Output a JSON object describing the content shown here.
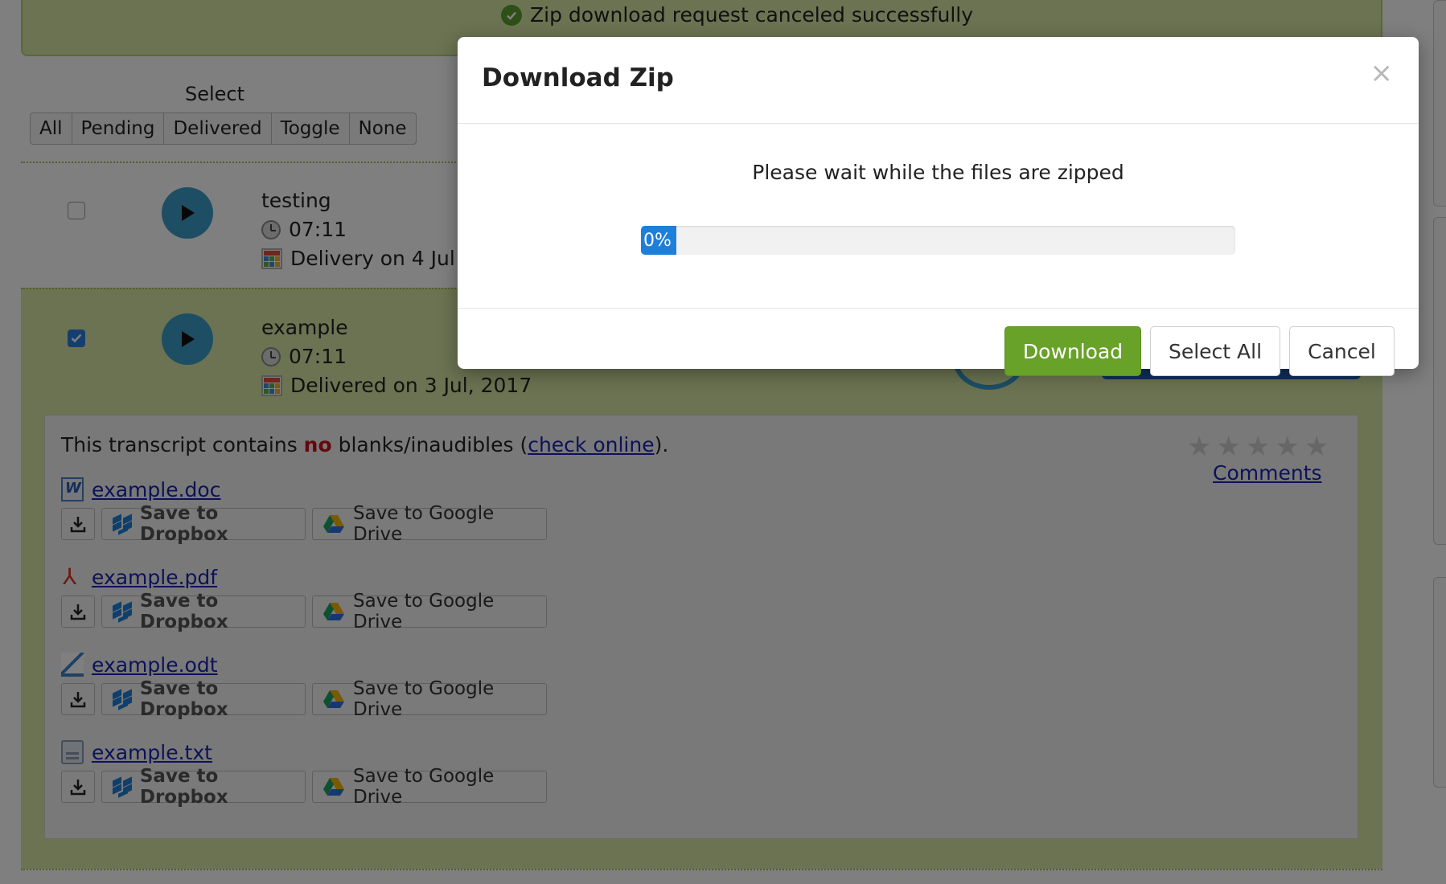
{
  "alert": {
    "message": "Zip download request canceled successfully"
  },
  "select": {
    "label": "Select",
    "options": [
      "All",
      "Pending",
      "Delivered",
      "Toggle",
      "None"
    ]
  },
  "jobs": [
    {
      "title": "testing",
      "duration": "07:11",
      "delivery": "Delivery on 4 Jul",
      "checked": false
    },
    {
      "title": "example",
      "duration": "07:11",
      "delivery": "Delivered on 3 Jul, 2017",
      "checked": true
    }
  ],
  "transcript": {
    "text_before": "This transcript contains ",
    "text_no": "no",
    "text_middle": " blanks/inaudibles (",
    "check_online": "check online",
    "text_after": ").",
    "comments": "Comments",
    "rating_max": 5,
    "rating": 0,
    "files": [
      {
        "name": "example.doc",
        "icon": "word-doc-icon"
      },
      {
        "name": "example.pdf",
        "icon": "pdf-icon"
      },
      {
        "name": "example.odt",
        "icon": "odt-icon"
      },
      {
        "name": "example.txt",
        "icon": "txt-icon"
      }
    ],
    "dropbox_label": "Save to Dropbox",
    "gdrive_label": "Save to Google Drive"
  },
  "modal": {
    "title": "Download Zip",
    "close": "×",
    "message": "Please wait while the files are zipped",
    "progress_percent": 0,
    "progress_label": "0%",
    "buttons": {
      "download": "Download",
      "select_all": "Select All",
      "cancel": "Cancel"
    }
  },
  "colors": {
    "accent_green": "#68a228",
    "progress_blue": "#1e7fd8",
    "link_blue": "#1a25b0",
    "highlight_green": "#d6e6a5",
    "no_red": "#c8101a"
  }
}
